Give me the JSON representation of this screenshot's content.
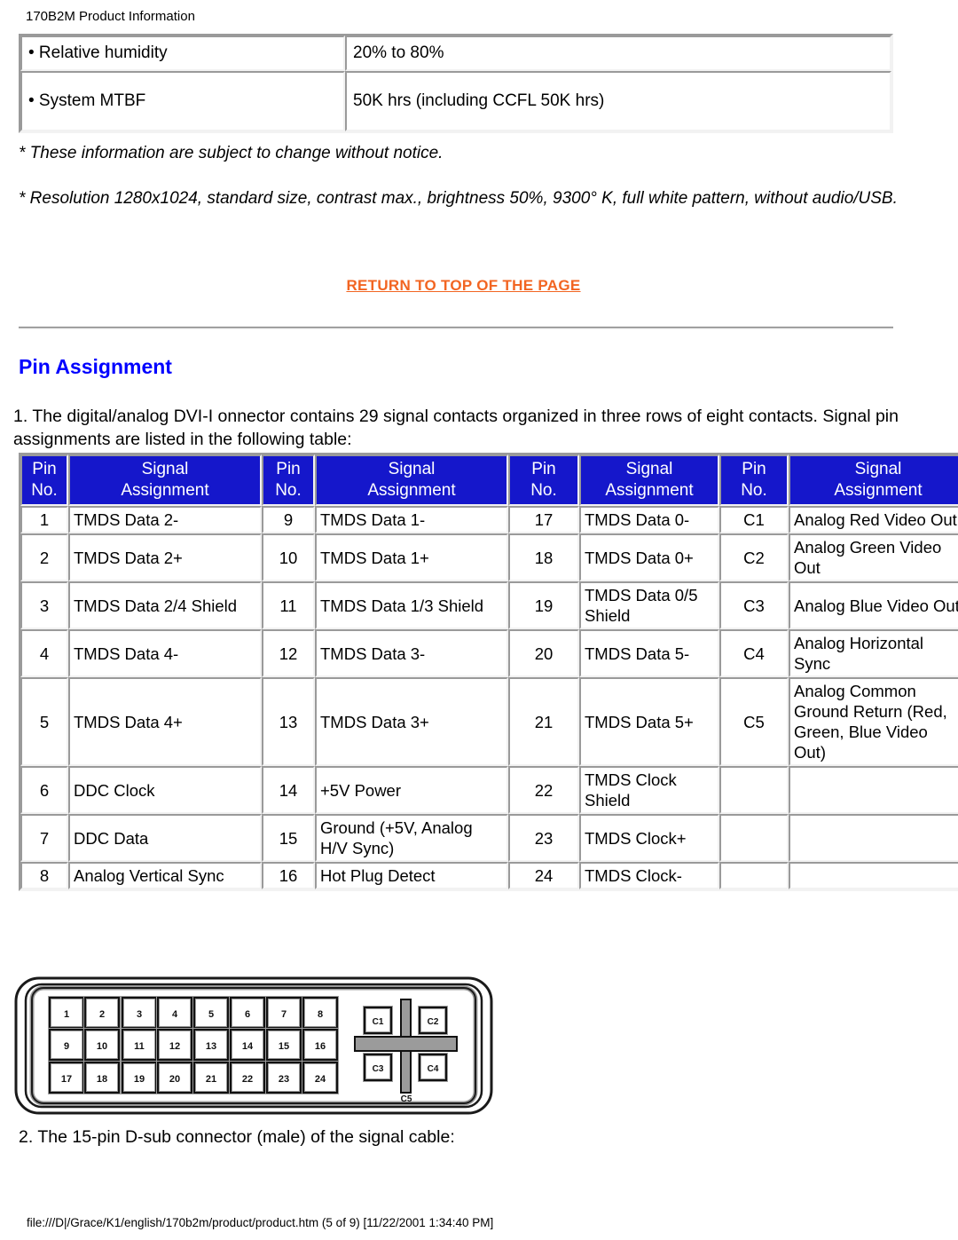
{
  "header": {
    "title": "170B2M Product Information"
  },
  "spec_table": {
    "rows": [
      {
        "label": "• Relative humidity",
        "value": "20% to 80%"
      },
      {
        "label": "• System MTBF",
        "value": "50K hrs (including CCFL 50K hrs)"
      }
    ]
  },
  "notes": {
    "note1": "* These information are subject to change without notice.",
    "note2": "* Resolution 1280x1024, standard size, contrast max., brightness 50%, 9300° K, full white pattern, without audio/USB."
  },
  "return_link": {
    "label": "RETURN TO TOP OF THE PAGE",
    "color": "#f26522"
  },
  "section": {
    "title": "Pin Assignment",
    "title_color": "#0000ff"
  },
  "intro": {
    "text": "1. The digital/analog DVI-I onnector contains 29 signal contacts organized in three rows of eight contacts. Signal pin assignments are listed in the following table:"
  },
  "pin_table": {
    "header_bg": "#1517cb",
    "headers": [
      {
        "num": "Pin No.",
        "sig": "Signal Assignment"
      },
      {
        "num": "Pin No.",
        "sig": "Signal Assignment"
      },
      {
        "num": "Pin No.",
        "sig": "Signal Assignment"
      },
      {
        "num": "Pin No.",
        "sig": "Signal Assignment"
      }
    ],
    "header_line1": "Pin",
    "header_line2": "No.",
    "header_sig_line1": "Signal",
    "header_sig_line2": "Assignment",
    "rows": [
      {
        "g1_num": "1",
        "g1_sig": "TMDS Data 2-",
        "g2_num": "9",
        "g2_sig": "TMDS Data 1-",
        "g3_num": "17",
        "g3_sig": "TMDS Data 0-",
        "g4_num": "C1",
        "g4_sig": "Analog Red Video Out"
      },
      {
        "g1_num": "2",
        "g1_sig": "TMDS Data 2+",
        "g2_num": "10",
        "g2_sig": "TMDS Data 1+",
        "g3_num": "18",
        "g3_sig": "TMDS Data 0+",
        "g4_num": "C2",
        "g4_sig": "Analog Green Video Out"
      },
      {
        "g1_num": "3",
        "g1_sig": "TMDS Data 2/4 Shield",
        "g2_num": "11",
        "g2_sig": "TMDS Data 1/3 Shield",
        "g3_num": "19",
        "g3_sig": "TMDS Data 0/5 Shield",
        "g4_num": "C3",
        "g4_sig": "Analog Blue Video Out"
      },
      {
        "g1_num": "4",
        "g1_sig": "TMDS Data 4-",
        "g2_num": "12",
        "g2_sig": "TMDS Data 3-",
        "g3_num": "20",
        "g3_sig": "TMDS Data 5-",
        "g4_num": "C4",
        "g4_sig": "Analog Horizontal Sync"
      },
      {
        "g1_num": "5",
        "g1_sig": "TMDS Data 4+",
        "g2_num": "13",
        "g2_sig": "TMDS Data 3+",
        "g3_num": "21",
        "g3_sig": "TMDS Data 5+",
        "g4_num": "C5",
        "g4_sig": "Analog Common Ground Return (Red, Green, Blue Video Out)"
      },
      {
        "g1_num": "6",
        "g1_sig": "DDC Clock",
        "g2_num": "14",
        "g2_sig": "+5V Power",
        "g3_num": "22",
        "g3_sig": "TMDS Clock Shield",
        "g4_num": "",
        "g4_sig": ""
      },
      {
        "g1_num": "7",
        "g1_sig": "DDC Data",
        "g2_num": "15",
        "g2_sig": "Ground (+5V, Analog H/V Sync)",
        "g3_num": "23",
        "g3_sig": "TMDS Clock+",
        "g4_num": "",
        "g4_sig": ""
      },
      {
        "g1_num": "8",
        "g1_sig": "Analog Vertical Sync",
        "g2_num": "16",
        "g2_sig": "Hot Plug Detect",
        "g3_num": "24",
        "g3_sig": "TMDS Clock-",
        "g4_num": "",
        "g4_sig": ""
      }
    ]
  },
  "connector_diagram": {
    "name": "dvi-i-connector",
    "row1": [
      "1",
      "2",
      "3",
      "4",
      "5",
      "6",
      "7",
      "8"
    ],
    "row2": [
      "9",
      "10",
      "11",
      "12",
      "13",
      "14",
      "15",
      "16"
    ],
    "row3": [
      "17",
      "18",
      "19",
      "20",
      "21",
      "22",
      "23",
      "24"
    ],
    "c_pins": [
      "C1",
      "C2",
      "C3",
      "C4"
    ],
    "c5_label": "C5"
  },
  "step2": {
    "text": "2. The 15-pin D-sub connector (male) of the signal cable:"
  },
  "footer": {
    "text": "file:///D|/Grace/K1/english/170b2m/product/product.htm (5 of 9) [11/22/2001 1:34:40 PM]"
  }
}
